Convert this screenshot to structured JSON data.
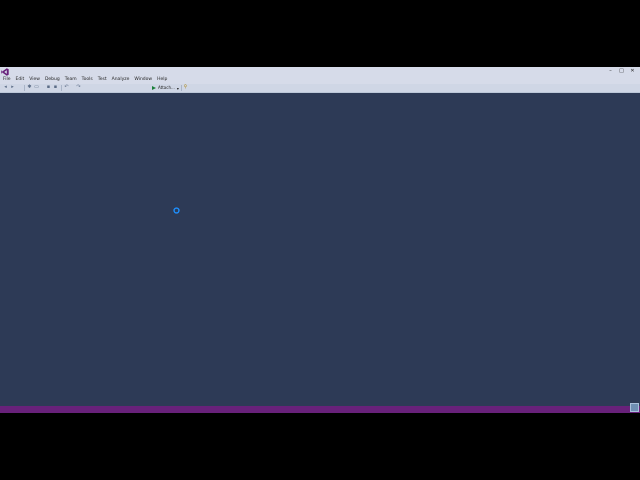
{
  "menu": {
    "items": [
      {
        "label": "File"
      },
      {
        "label": "Edit"
      },
      {
        "label": "View"
      },
      {
        "label": "Debug"
      },
      {
        "label": "Team"
      },
      {
        "label": "Tools"
      },
      {
        "label": "Test"
      },
      {
        "label": "Analyze"
      },
      {
        "label": "Window"
      },
      {
        "label": "Help"
      }
    ]
  },
  "toolbar": {
    "start_label": "Attach...",
    "icons": [
      "navigate-back-icon",
      "navigate-forward-icon",
      "new-project-icon",
      "open-file-icon",
      "save-icon",
      "save-all-icon",
      "undo-icon",
      "redo-icon",
      "start-icon",
      "find-icon"
    ]
  },
  "window_controls": {
    "minimize": "–",
    "maximize": "□",
    "close": "✕"
  },
  "colors": {
    "background": "#2d3a56",
    "chrome": "#d6dbe9",
    "status_bar": "#68217a",
    "spinner": "#1e90ff"
  }
}
